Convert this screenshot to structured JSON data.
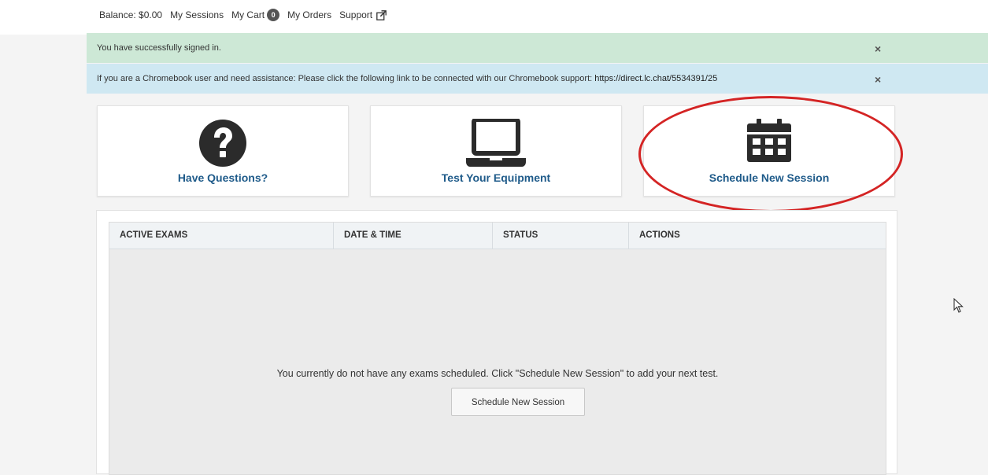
{
  "topnav": {
    "balance": "Balance: $0.00",
    "my_sessions": "My Sessions",
    "my_cart": "My Cart",
    "cart_count": "0",
    "my_orders": "My Orders",
    "support": "Support"
  },
  "alerts": {
    "success": {
      "text": "You have successfully signed in.",
      "close": "×"
    },
    "info": {
      "text": "If you are a Chromebook user and need assistance: Please click the following link to be connected with our Chromebook support: ",
      "link": "https://direct.lc.chat/5534391/25",
      "close": "×"
    }
  },
  "cards": [
    {
      "label": "Have Questions?",
      "icon": "question-circle-icon"
    },
    {
      "label": "Test Your Equipment",
      "icon": "laptop-icon"
    },
    {
      "label": "Schedule New Session",
      "icon": "calendar-icon"
    }
  ],
  "table": {
    "headers": [
      "ACTIVE EXAMS",
      "DATE & TIME",
      "STATUS",
      "ACTIONS"
    ],
    "empty_message": "You currently do not have any exams scheduled. Click \"Schedule New Session\" to add your next test.",
    "button_label": "Schedule New Session"
  },
  "colors": {
    "accent_text": "#1f5b8a",
    "success_bg": "#cde8d6",
    "info_bg": "#cfe8f2",
    "annotation": "#d42424"
  }
}
